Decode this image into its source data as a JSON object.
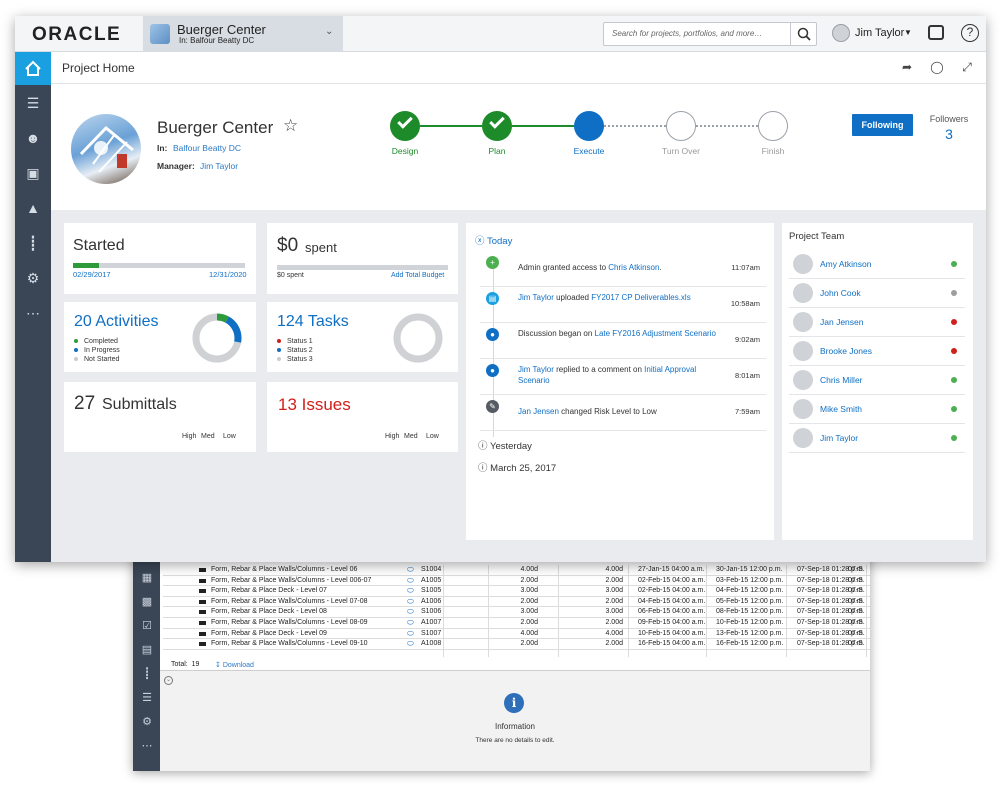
{
  "topbar": {
    "logo": "ORACLE",
    "project_name": "Buerger Center",
    "project_in": "In: Balfour Beatty DC",
    "search_placeholder": "Search for projects, portfolios, and more…",
    "user_name": "Jim Taylor"
  },
  "page": {
    "title": "Project Home"
  },
  "hero": {
    "title": "Buerger Center",
    "in_label": "In:",
    "in_value": "Balfour Beatty DC",
    "manager_label": "Manager:",
    "manager_value": "Jim Taylor",
    "stages": [
      {
        "label": "Design",
        "state": "done"
      },
      {
        "label": "Plan",
        "state": "done"
      },
      {
        "label": "Execute",
        "state": "current"
      },
      {
        "label": "Turn Over",
        "state": "todo"
      },
      {
        "label": "Finish",
        "state": "todo"
      }
    ],
    "follow_label": "Following",
    "followers_label": "Followers",
    "followers_count": "3"
  },
  "cards": {
    "started": {
      "title": "Started",
      "start": "02/29/2017",
      "end": "12/31/2020",
      "progress": 0.15
    },
    "spent": {
      "amount": "$0",
      "suffix": "spent",
      "sub": "$0 spent",
      "link": "Add Total Budget"
    },
    "activities": {
      "title": "20 Activities",
      "legend": [
        "Completed",
        "In Progress",
        "Not Started"
      ],
      "completed_fraction": 0.08,
      "in_progress_fraction": 0.2
    },
    "tasks": {
      "title": "124 Tasks",
      "legend": [
        "Status 1",
        "Status 2",
        "Status 3"
      ]
    },
    "submittals": {
      "count": "27",
      "label": "Submittals",
      "h": "High",
      "m": "Med",
      "l": "Low"
    },
    "issues": {
      "title": "13 Issues",
      "h": "High",
      "m": "Med",
      "l": "Low"
    }
  },
  "feed": {
    "today": "Today",
    "items": [
      {
        "pre": "Admin granted access to ",
        "link": "Chris Atkinson",
        "post": ".",
        "link2": "",
        "time": "11:07am",
        "icon": "plus-icon",
        "color": "#4caf50"
      },
      {
        "pre": "",
        "link": "Jim Taylor",
        "post": " uploaded ",
        "link2": "FY2017 CP Deliverables.xls",
        "time": "10:58am",
        "icon": "document-icon",
        "color": "#1aa0e0"
      },
      {
        "pre": "Discussion began on ",
        "link": "Late FY2016 Adjustment Scenario",
        "post": "",
        "link2": "",
        "time": "9:02am",
        "icon": "comment-icon",
        "color": "#0f6fc4"
      },
      {
        "pre": "",
        "link": "Jim Taylor",
        "post": " replied to a comment on ",
        "link2": "Initial Approval Scenario",
        "time": "8:01am",
        "icon": "comment-icon",
        "color": "#0f6fc4"
      },
      {
        "pre": "",
        "link": "Jan Jensen",
        "post": " changed Risk Level to Low",
        "link2": "",
        "time": "7:59am",
        "icon": "pencil-icon",
        "color": "#555b63"
      }
    ],
    "yesterday": "Yesterday",
    "older": "March 25, 2017"
  },
  "team": {
    "title": "Project Team",
    "members": [
      {
        "name": "Amy Atkinson",
        "status": "#4caf50"
      },
      {
        "name": "John Cook",
        "status": "#9e9e9e"
      },
      {
        "name": "Jan Jensen",
        "status": "#d0201b"
      },
      {
        "name": "Brooke Jones",
        "status": "#d0201b"
      },
      {
        "name": "Chris Miller",
        "status": "#4caf50"
      },
      {
        "name": "Mike Smith",
        "status": "#4caf50"
      },
      {
        "name": "Jim Taylor",
        "status": "#4caf50"
      }
    ]
  },
  "back": {
    "rows": [
      {
        "name": "Form, Rebar & Place Walls/Columns - Level 06",
        "id": "S1004",
        "d1": "4.00d",
        "d2": "4.00d",
        "s1": "27-Jan-15 04:00 a.m.",
        "s2": "30-Jan-15 12:00 p.m.",
        "s3": "07-Sep-18 01:28 p.m.",
        "s4": "07-S"
      },
      {
        "name": "Form, Rebar & Place Walls/Columns - Level 006-07",
        "id": "A1005",
        "d1": "2.00d",
        "d2": "2.00d",
        "s1": "02-Feb-15 04:00 a.m.",
        "s2": "03-Feb-15 12:00 p.m.",
        "s3": "07-Sep-18 01:28 p.m.",
        "s4": "07-S"
      },
      {
        "name": "Form, Rebar & Place Deck - Level 07",
        "id": "S1005",
        "d1": "3.00d",
        "d2": "3.00d",
        "s1": "02-Feb-15 04:00 a.m.",
        "s2": "04-Feb-15 12:00 p.m.",
        "s3": "07-Sep-18 01:28 p.m.",
        "s4": "07-S"
      },
      {
        "name": "Form, Rebar & Place Walls/Columns - Level 07-08",
        "id": "A1006",
        "d1": "2.00d",
        "d2": "2.00d",
        "s1": "04-Feb-15 04:00 a.m.",
        "s2": "05-Feb-15 12:00 p.m.",
        "s3": "07-Sep-18 01:28 p.m.",
        "s4": "07-S"
      },
      {
        "name": "Form, Rebar & Place Deck - Level 08",
        "id": "S1006",
        "d1": "3.00d",
        "d2": "3.00d",
        "s1": "06-Feb-15 04:00 a.m.",
        "s2": "08-Feb-15 12:00 p.m.",
        "s3": "07-Sep-18 01:28 p.m.",
        "s4": "07-S"
      },
      {
        "name": "Form, Rebar & Place Walls/Columns - Level 08-09",
        "id": "A1007",
        "d1": "2.00d",
        "d2": "2.00d",
        "s1": "09-Feb-15 04:00 a.m.",
        "s2": "10-Feb-15 12:00 p.m.",
        "s3": "07-Sep-18 01:28 p.m.",
        "s4": "07-S"
      },
      {
        "name": "Form, Rebar & Place Deck - Level 09",
        "id": "S1007",
        "d1": "4.00d",
        "d2": "4.00d",
        "s1": "10-Feb-15 04:00 a.m.",
        "s2": "13-Feb-15 12:00 p.m.",
        "s3": "07-Sep-18 01:28 p.m.",
        "s4": "07-S"
      },
      {
        "name": "Form, Rebar & Place Walls/Columns - Level 09-10",
        "id": "A1008",
        "d1": "2.00d",
        "d2": "2.00d",
        "s1": "16-Feb-15 04:00 a.m.",
        "s2": "16-Feb-15 12:00 p.m.",
        "s3": "07-Sep-18 01:28 p.m.",
        "s4": "07-S"
      }
    ],
    "total_label": "Total:",
    "total_value": "19",
    "download": "Download",
    "info_title": "Information",
    "info_text": "There are no details to edit."
  }
}
